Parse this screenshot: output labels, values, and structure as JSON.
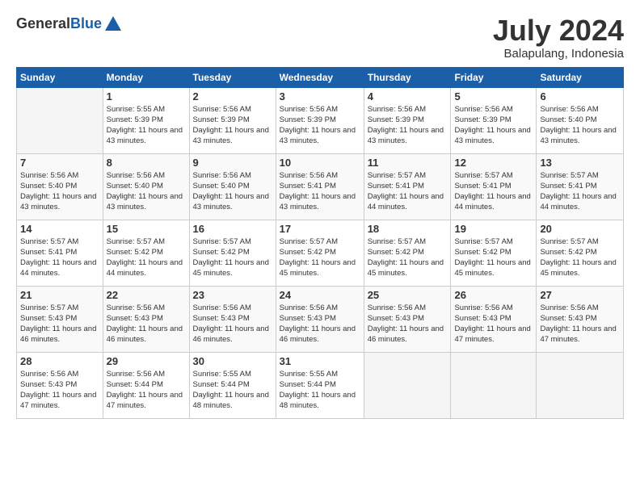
{
  "logo": {
    "general": "General",
    "blue": "Blue"
  },
  "title": "July 2024",
  "location": "Balapulang, Indonesia",
  "days_header": [
    "Sunday",
    "Monday",
    "Tuesday",
    "Wednesday",
    "Thursday",
    "Friday",
    "Saturday"
  ],
  "weeks": [
    [
      {
        "num": "",
        "empty": true
      },
      {
        "num": "1",
        "sunrise": "Sunrise: 5:55 AM",
        "sunset": "Sunset: 5:39 PM",
        "daylight": "Daylight: 11 hours and 43 minutes."
      },
      {
        "num": "2",
        "sunrise": "Sunrise: 5:56 AM",
        "sunset": "Sunset: 5:39 PM",
        "daylight": "Daylight: 11 hours and 43 minutes."
      },
      {
        "num": "3",
        "sunrise": "Sunrise: 5:56 AM",
        "sunset": "Sunset: 5:39 PM",
        "daylight": "Daylight: 11 hours and 43 minutes."
      },
      {
        "num": "4",
        "sunrise": "Sunrise: 5:56 AM",
        "sunset": "Sunset: 5:39 PM",
        "daylight": "Daylight: 11 hours and 43 minutes."
      },
      {
        "num": "5",
        "sunrise": "Sunrise: 5:56 AM",
        "sunset": "Sunset: 5:39 PM",
        "daylight": "Daylight: 11 hours and 43 minutes."
      },
      {
        "num": "6",
        "sunrise": "Sunrise: 5:56 AM",
        "sunset": "Sunset: 5:40 PM",
        "daylight": "Daylight: 11 hours and 43 minutes."
      }
    ],
    [
      {
        "num": "7",
        "sunrise": "Sunrise: 5:56 AM",
        "sunset": "Sunset: 5:40 PM",
        "daylight": "Daylight: 11 hours and 43 minutes."
      },
      {
        "num": "8",
        "sunrise": "Sunrise: 5:56 AM",
        "sunset": "Sunset: 5:40 PM",
        "daylight": "Daylight: 11 hours and 43 minutes."
      },
      {
        "num": "9",
        "sunrise": "Sunrise: 5:56 AM",
        "sunset": "Sunset: 5:40 PM",
        "daylight": "Daylight: 11 hours and 43 minutes."
      },
      {
        "num": "10",
        "sunrise": "Sunrise: 5:56 AM",
        "sunset": "Sunset: 5:41 PM",
        "daylight": "Daylight: 11 hours and 43 minutes."
      },
      {
        "num": "11",
        "sunrise": "Sunrise: 5:57 AM",
        "sunset": "Sunset: 5:41 PM",
        "daylight": "Daylight: 11 hours and 44 minutes."
      },
      {
        "num": "12",
        "sunrise": "Sunrise: 5:57 AM",
        "sunset": "Sunset: 5:41 PM",
        "daylight": "Daylight: 11 hours and 44 minutes."
      },
      {
        "num": "13",
        "sunrise": "Sunrise: 5:57 AM",
        "sunset": "Sunset: 5:41 PM",
        "daylight": "Daylight: 11 hours and 44 minutes."
      }
    ],
    [
      {
        "num": "14",
        "sunrise": "Sunrise: 5:57 AM",
        "sunset": "Sunset: 5:41 PM",
        "daylight": "Daylight: 11 hours and 44 minutes."
      },
      {
        "num": "15",
        "sunrise": "Sunrise: 5:57 AM",
        "sunset": "Sunset: 5:42 PM",
        "daylight": "Daylight: 11 hours and 44 minutes."
      },
      {
        "num": "16",
        "sunrise": "Sunrise: 5:57 AM",
        "sunset": "Sunset: 5:42 PM",
        "daylight": "Daylight: 11 hours and 45 minutes."
      },
      {
        "num": "17",
        "sunrise": "Sunrise: 5:57 AM",
        "sunset": "Sunset: 5:42 PM",
        "daylight": "Daylight: 11 hours and 45 minutes."
      },
      {
        "num": "18",
        "sunrise": "Sunrise: 5:57 AM",
        "sunset": "Sunset: 5:42 PM",
        "daylight": "Daylight: 11 hours and 45 minutes."
      },
      {
        "num": "19",
        "sunrise": "Sunrise: 5:57 AM",
        "sunset": "Sunset: 5:42 PM",
        "daylight": "Daylight: 11 hours and 45 minutes."
      },
      {
        "num": "20",
        "sunrise": "Sunrise: 5:57 AM",
        "sunset": "Sunset: 5:42 PM",
        "daylight": "Daylight: 11 hours and 45 minutes."
      }
    ],
    [
      {
        "num": "21",
        "sunrise": "Sunrise: 5:57 AM",
        "sunset": "Sunset: 5:43 PM",
        "daylight": "Daylight: 11 hours and 46 minutes."
      },
      {
        "num": "22",
        "sunrise": "Sunrise: 5:56 AM",
        "sunset": "Sunset: 5:43 PM",
        "daylight": "Daylight: 11 hours and 46 minutes."
      },
      {
        "num": "23",
        "sunrise": "Sunrise: 5:56 AM",
        "sunset": "Sunset: 5:43 PM",
        "daylight": "Daylight: 11 hours and 46 minutes."
      },
      {
        "num": "24",
        "sunrise": "Sunrise: 5:56 AM",
        "sunset": "Sunset: 5:43 PM",
        "daylight": "Daylight: 11 hours and 46 minutes."
      },
      {
        "num": "25",
        "sunrise": "Sunrise: 5:56 AM",
        "sunset": "Sunset: 5:43 PM",
        "daylight": "Daylight: 11 hours and 46 minutes."
      },
      {
        "num": "26",
        "sunrise": "Sunrise: 5:56 AM",
        "sunset": "Sunset: 5:43 PM",
        "daylight": "Daylight: 11 hours and 47 minutes."
      },
      {
        "num": "27",
        "sunrise": "Sunrise: 5:56 AM",
        "sunset": "Sunset: 5:43 PM",
        "daylight": "Daylight: 11 hours and 47 minutes."
      }
    ],
    [
      {
        "num": "28",
        "sunrise": "Sunrise: 5:56 AM",
        "sunset": "Sunset: 5:43 PM",
        "daylight": "Daylight: 11 hours and 47 minutes."
      },
      {
        "num": "29",
        "sunrise": "Sunrise: 5:56 AM",
        "sunset": "Sunset: 5:44 PM",
        "daylight": "Daylight: 11 hours and 47 minutes."
      },
      {
        "num": "30",
        "sunrise": "Sunrise: 5:55 AM",
        "sunset": "Sunset: 5:44 PM",
        "daylight": "Daylight: 11 hours and 48 minutes."
      },
      {
        "num": "31",
        "sunrise": "Sunrise: 5:55 AM",
        "sunset": "Sunset: 5:44 PM",
        "daylight": "Daylight: 11 hours and 48 minutes."
      },
      {
        "num": "",
        "empty": true
      },
      {
        "num": "",
        "empty": true
      },
      {
        "num": "",
        "empty": true
      }
    ]
  ]
}
